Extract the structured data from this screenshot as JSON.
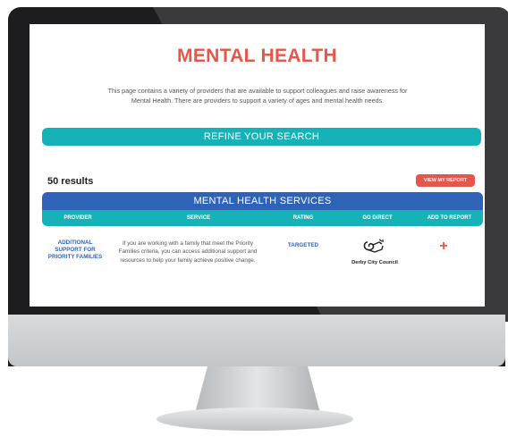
{
  "page": {
    "title": "MENTAL HEALTH",
    "intro": "This page contains a variety of providers that are available to support colleagues and raise awareness for Mental Health. There are providers to support a variety of ages and mental health needs."
  },
  "search": {
    "refine_label": "REFINE YOUR SEARCH"
  },
  "results": {
    "count_label": "50 results",
    "view_report_label": "VIEW MY REPORT"
  },
  "table": {
    "title": "MENTAL HEALTH SERVICES",
    "headers": {
      "provider": "PROVIDER",
      "service": "SERVICE",
      "rating": "RATING",
      "go_direct": "GO DIRECT",
      "add_to_report": "ADD TO REPORT"
    },
    "rows": [
      {
        "provider": "ADDITIONAL SUPPORT FOR PRIORITY FAMILIES",
        "service": "If you are working with a family that meet the Priority Families criteria, you can access additional support and resources to help your family achieve positive change.",
        "rating": "TARGETED",
        "go_direct_name": "Derby City Council",
        "add_symbol": "+"
      }
    ]
  },
  "colors": {
    "accent_red": "#e4574a",
    "teal": "#15b3b8",
    "blue": "#2f63b7",
    "monitor_frame": "#1d1d1f"
  },
  "icons": {
    "go_direct": "derby-ram-logo-icon",
    "add": "plus-icon"
  }
}
